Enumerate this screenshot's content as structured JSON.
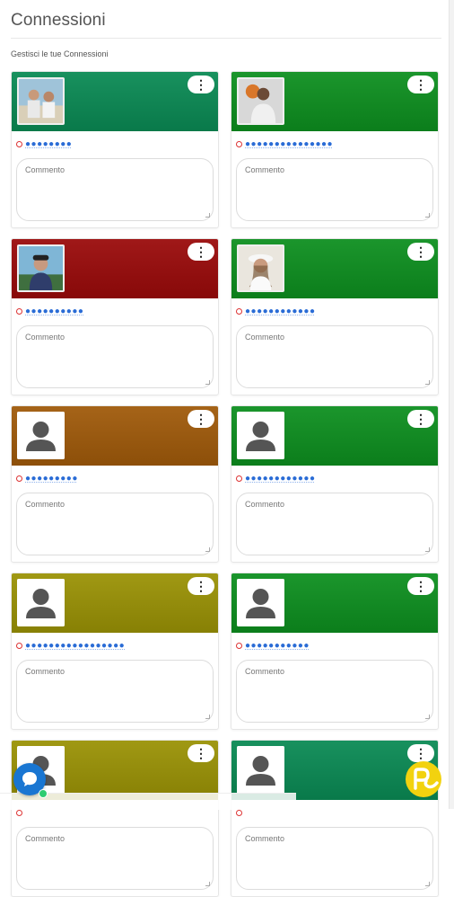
{
  "page": {
    "title": "Connessioni",
    "subtitle": "Gestisci le tue Connessioni"
  },
  "cards": [
    {
      "banner_color": "#0a8a54",
      "avatar": "photo-beach",
      "name": "●●●●●●●●",
      "comment_placeholder": "Commento",
      "menu_icon": "⋮"
    },
    {
      "banner_color": "#0d8f1f",
      "avatar": "photo-basketball",
      "name": "●●●●●●●●●●●●●●●",
      "comment_placeholder": "Commento",
      "menu_icon": "⋮"
    },
    {
      "banner_color": "#9a0a0a",
      "avatar": "photo-man-cap",
      "name": "●●●●●●●●●●",
      "comment_placeholder": "Commento",
      "menu_icon": "⋮"
    },
    {
      "banner_color": "#0d8f1f",
      "avatar": "photo-woman-hat",
      "name": "●●●●●●●●●●●●",
      "comment_placeholder": "Commento",
      "menu_icon": "⋮"
    },
    {
      "banner_color": "#a05a0a",
      "avatar": "placeholder",
      "name": "●●●●●●●●●",
      "comment_placeholder": "Commento",
      "menu_icon": "⋮"
    },
    {
      "banner_color": "#0d8f1f",
      "avatar": "placeholder",
      "name": "●●●●●●●●●●●●",
      "comment_placeholder": "Commento",
      "menu_icon": "⋮"
    },
    {
      "banner_color": "#9a9205",
      "avatar": "placeholder",
      "name": "●●●●●●●●●●●●●●●●●",
      "comment_placeholder": "Commento",
      "menu_icon": "⋮"
    },
    {
      "banner_color": "#0d8f1f",
      "avatar": "placeholder",
      "name": "●●●●●●●●●●●",
      "comment_placeholder": "Commento",
      "menu_icon": "⋮"
    },
    {
      "banner_color": "#9a9205",
      "avatar": "placeholder",
      "name": "",
      "comment_placeholder": "Commento",
      "menu_icon": "⋮"
    },
    {
      "banner_color": "#0a8a54",
      "avatar": "placeholder",
      "name": "",
      "comment_placeholder": "Commento",
      "menu_icon": "⋮"
    }
  ],
  "colors": {
    "link": "#2a6cd6",
    "status_offline": "#dd3333",
    "chat_button": "#1976d2",
    "brand_button": "#f2d20f"
  },
  "icons": {
    "chat": "chat-bubble-icon",
    "brand": "brand-logo-icon",
    "avatar_default": "user-silhouette-icon"
  }
}
